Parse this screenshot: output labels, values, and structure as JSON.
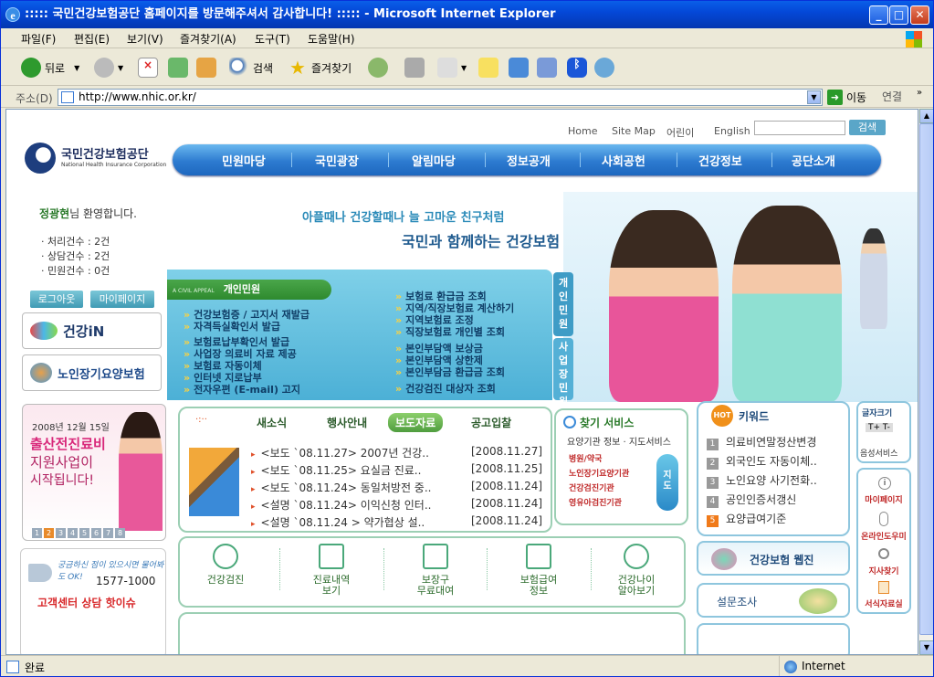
{
  "window": {
    "title": ":::::  국민건강보험공단 홈페이지를 방문해주셔서 감사합니다!  :::::  - Microsoft Internet Explorer"
  },
  "menu": [
    "파일(F)",
    "편집(E)",
    "보기(V)",
    "즐겨찾기(A)",
    "도구(T)",
    "도움말(H)"
  ],
  "toolbar": {
    "back": "뒤로",
    "search": "검색",
    "favorites": "즐겨찾기"
  },
  "address": {
    "label": "주소(D)",
    "url": "http://www.nhic.or.kr/",
    "go": "이동",
    "links": "연결"
  },
  "status": {
    "text": "완료",
    "zone": "Internet"
  },
  "page": {
    "topnav": [
      "Home",
      "Site Map",
      "어린이",
      "English"
    ],
    "search_btn": "검색",
    "logo_title": "국민건강보험공단",
    "logo_sub": "National Health Insurance Corporation",
    "gnb": [
      "민원마당",
      "국민광장",
      "알림마당",
      "정보공개",
      "사회공헌",
      "건강정보",
      "공단소개"
    ],
    "welcome_name": "정광현",
    "welcome_rest": "님 환영합니다.",
    "stats": [
      "· 처리건수 :  2건",
      "· 상담건수 :  2건",
      "· 민원건수 :  0건"
    ],
    "logout": "로그아웃",
    "mypage": "마이페이지",
    "banner1": "건강iN",
    "banner2": "노인장기요양보험",
    "slogan1": "아플때나 건강할때나   늘 고마운 친구처럼",
    "slogan2": "국민과 함께하는 건강보험",
    "civil_small": "A CIVIL APPEAL",
    "civil_title": "개인민원",
    "civil_tab_personal": "개인민원",
    "civil_tab_business": "사업장민원",
    "civil_left": [
      "건강보험증 / 고지서 재발급",
      "자격득실확인서 발급",
      "보험료납부확인서 발급",
      "사업장 의료비 자료 제공",
      "보험료 자동이체",
      "인터넷 지로납부",
      "전자우편 (E-mail) 고지"
    ],
    "civil_right": [
      "보험료 환급금 조회",
      "지역/직장보험료 계산하기",
      "지역보험료 조정",
      "직장보험료 개인별 조회",
      "본인부담액 보상금",
      "본인부담액 상한제",
      "본인부담금 환급금 조회",
      "건강검진 대상자 조회"
    ],
    "ad_date": "2008년 12월 15일",
    "ad_line1": "출산전진료비",
    "ad_line2": "지원사업이",
    "ad_line3": "시작됩니다!",
    "pager": [
      "1",
      "2",
      "3",
      "4",
      "5",
      "6",
      "7",
      "8"
    ],
    "call_line1": "궁금하신 점이 있으시면 물어봐도 OK!",
    "call_number": "1577-1000",
    "call_center": "고객센터 상담 핫이슈",
    "news_tabs": [
      "새소식",
      "행사안내",
      "보도자료",
      "공고입찰"
    ],
    "news": [
      {
        "title": "<보도 `08.11.27> 2007년 건강..",
        "date": "[2008.11.27]"
      },
      {
        "title": "<보도 `08.11.25> 요실금 진료..",
        "date": "[2008.11.25]"
      },
      {
        "title": "<보도 `08.11.24> 동일처방전 중..",
        "date": "[2008.11.24]"
      },
      {
        "title": "<설명 `08.11.24> 이익신청 인터..",
        "date": "[2008.11.24]"
      },
      {
        "title": "<설명 `08.11.24 > 약가협상 설..",
        "date": "[2008.11.24]"
      }
    ],
    "find_title": "찾기 서비스",
    "find_sub": "요양기관 정보 · 지도서비스",
    "find_items": [
      "병원/약국",
      "노인장기요양기관",
      "건강검진기관",
      "영유아검진기관"
    ],
    "find_map": "지도",
    "keyword_title": "키워드",
    "keywords": [
      "의료비연말정산변경",
      "외국인도 자동이체..",
      "노인요양 사기전화..",
      "공인인증서갱신",
      "요양급여기준"
    ],
    "services": [
      "건강검진",
      "진료내역\n보기",
      "보장구\n무료대여",
      "보험급여\n정보",
      "건강나이\n알아보기"
    ],
    "webzine": "건강보험 웹진",
    "survey": "설문조사",
    "rightcol": {
      "fontsize": "글자크기",
      "voice": "음성서비스",
      "mypage": "마이페이지",
      "online": "온라인도우미",
      "branch": "지사찾기",
      "forms": "서식자료실"
    }
  }
}
